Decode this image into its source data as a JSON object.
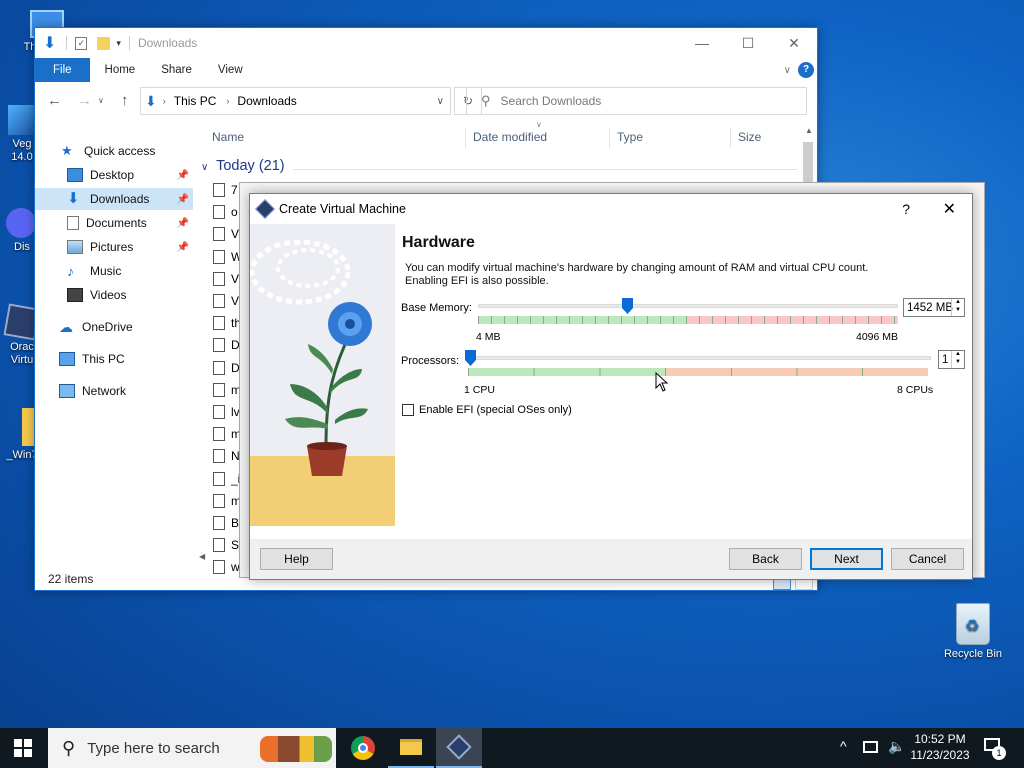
{
  "desktop": {
    "icons": [
      {
        "label": "Th"
      },
      {
        "label": "Veg\n14.0"
      },
      {
        "label": "Dis"
      },
      {
        "label": "Orac\nVirtu"
      },
      {
        "label": "_Win7"
      },
      {
        "label": "Recycle Bin"
      }
    ]
  },
  "explorer": {
    "title": "Downloads",
    "ribbon_tabs": [
      "File",
      "Home",
      "Share",
      "View"
    ],
    "breadcrumb": [
      "This PC",
      "Downloads"
    ],
    "search_placeholder": "Search Downloads",
    "nav": {
      "quick_access": "Quick access",
      "items": [
        "Desktop",
        "Downloads",
        "Documents",
        "Pictures",
        "Music",
        "Videos"
      ],
      "onedrive": "OneDrive",
      "this_pc": "This PC",
      "network": "Network"
    },
    "columns": [
      "Name",
      "Date modified",
      "Type",
      "Size"
    ],
    "group": "Today (21)",
    "file_prefixes": [
      "7",
      "o",
      "V",
      "W",
      "V",
      "V",
      "th",
      "D",
      "D",
      "m",
      "lv",
      "m",
      "N",
      "_i",
      "m",
      "B",
      "S",
      "w"
    ],
    "status": "22 items"
  },
  "dialog": {
    "title": "Create Virtual Machine",
    "help_glyph": "?",
    "heading": "Hardware",
    "description": "You can modify virtual machine's hardware by changing amount of RAM and virtual CPU count. Enabling EFI is also possible.",
    "memory": {
      "label": "Base Memory:",
      "value": "1452 MB",
      "min_label": "4 MB",
      "max_label": "4096 MB",
      "fraction": 0.354
    },
    "processors": {
      "label": "Processors:",
      "value": "1",
      "min_label": "1 CPU",
      "max_label": "8 CPUs",
      "fraction": 0.0
    },
    "efi": {
      "label": "Enable EFI (special OSes only)",
      "checked": false
    },
    "buttons": {
      "help": "Help",
      "back": "Back",
      "next": "Next",
      "cancel": "Cancel"
    }
  },
  "taskbar": {
    "search_placeholder": "Type here to search",
    "time": "10:52 PM",
    "date": "11/23/2023",
    "notification_count": "1"
  },
  "colors": {
    "accent": "#0078d7",
    "slider_green": "#7ed37e",
    "slider_red": "#f29a9a"
  }
}
